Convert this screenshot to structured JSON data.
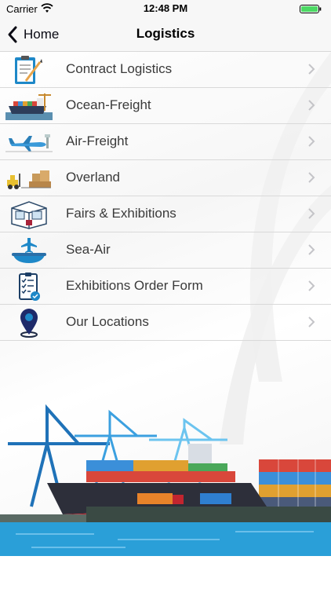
{
  "status_bar": {
    "carrier": "Carrier",
    "time": "12:48 PM"
  },
  "nav": {
    "back_label": "Home",
    "title": "Logistics"
  },
  "menu": {
    "items": [
      {
        "label": "Contract Logistics",
        "icon": "clipboard-contract-icon"
      },
      {
        "label": "Ocean-Freight",
        "icon": "cargo-ship-icon"
      },
      {
        "label": "Air-Freight",
        "icon": "airplane-icon"
      },
      {
        "label": "Overland",
        "icon": "forklift-boxes-icon"
      },
      {
        "label": "Fairs & Exhibitions",
        "icon": "exhibition-booth-icon"
      },
      {
        "label": "Sea-Air",
        "icon": "sea-air-icon"
      },
      {
        "label": "Exhibitions Order Form",
        "icon": "checklist-icon"
      },
      {
        "label": "Our Locations",
        "icon": "location-pin-icon"
      }
    ]
  },
  "colors": {
    "accent": "#0a0a14",
    "icon_blue": "#1e88c8",
    "port_water": "#2a9fd8"
  }
}
